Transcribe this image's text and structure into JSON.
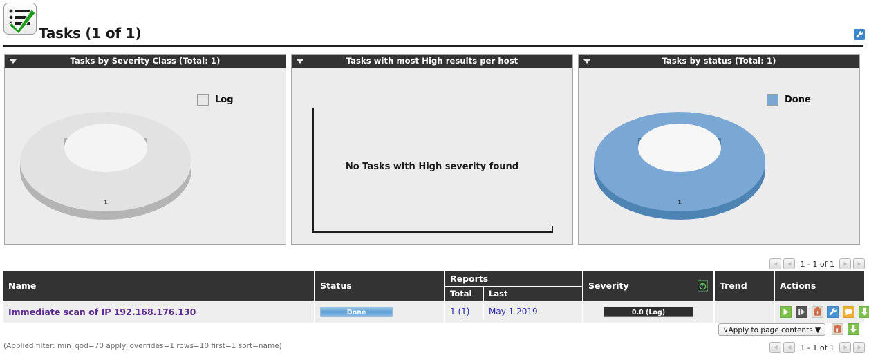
{
  "header": {
    "title": "Tasks (1 of 1)",
    "icon": "tasks-checklist-icon",
    "edit_icon": "wrench-icon"
  },
  "panels": [
    {
      "id": "severity-class",
      "title": "Tasks by Severity Class (Total: 1)",
      "toggle_icon": "chevron-down-icon",
      "legend": [
        {
          "label": "Log",
          "color": "#e6e6e6"
        }
      ],
      "value_label": "1"
    },
    {
      "id": "most-high-results",
      "title": "Tasks with most High results per host",
      "toggle_icon": "chevron-down-icon",
      "empty_message": "No Tasks with High severity found"
    },
    {
      "id": "by-status",
      "title": "Tasks by status (Total: 1)",
      "toggle_icon": "chevron-down-icon",
      "legend": [
        {
          "label": "Done",
          "color": "#7ba7d4"
        }
      ],
      "value_label": "1"
    }
  ],
  "chart_data": [
    {
      "type": "pie",
      "title": "Tasks by Severity Class (Total: 1)",
      "labels": [
        "Log"
      ],
      "values": [
        1
      ],
      "colors": [
        "#e6e6e6"
      ],
      "donut": true,
      "legend_position": "top-right",
      "data_labels": [
        "1"
      ],
      "total": 1
    },
    {
      "type": "bar",
      "title": "Tasks with most High results per host",
      "categories": [],
      "values": [],
      "xlabel": "",
      "ylabel": "",
      "grid": false,
      "empty_message": "No Tasks with High severity found"
    },
    {
      "type": "pie",
      "title": "Tasks by status (Total: 1)",
      "labels": [
        "Done"
      ],
      "values": [
        1
      ],
      "colors": [
        "#7ba7d4"
      ],
      "donut": true,
      "legend_position": "top-right",
      "data_labels": [
        "1"
      ],
      "total": 1
    }
  ],
  "pagination": {
    "range_label": "1 - 1 of 1",
    "first_icon": "first-page-icon",
    "prev_icon": "previous-page-icon",
    "next_icon": "next-page-icon",
    "last_icon": "last-page-icon"
  },
  "table": {
    "columns": {
      "name": "Name",
      "status": "Status",
      "reports": "Reports",
      "reports_total": "Total",
      "reports_last": "Last",
      "severity": "Severity",
      "trend": "Trend",
      "actions": "Actions"
    },
    "severity_override_icon": "overrides-enabled-icon",
    "rows": [
      {
        "name": "Immediate scan of IP 192.168.176.130",
        "status": "Done",
        "reports_total": "1 (1)",
        "reports_last": "May 1 2019",
        "severity": "0.0 (Log)",
        "trend": "",
        "actions": [
          {
            "name": "start-task-icon",
            "title": "Start"
          },
          {
            "name": "resume-task-icon",
            "title": "Resume"
          },
          {
            "name": "trash-icon",
            "title": "Move to Trashcan"
          },
          {
            "name": "edit-task-icon",
            "title": "Edit Task"
          },
          {
            "name": "clone-task-icon",
            "title": "Clone"
          },
          {
            "name": "export-task-icon",
            "title": "Export Task"
          }
        ]
      }
    ]
  },
  "footer": {
    "apply_to_page_contents": "∨Apply to page contents",
    "trash_icon": "trash-icon",
    "export_icon": "export-icon",
    "filter_note": "(Applied filter: min_qod=70 apply_overrides=1 rows=10 first=1 sort=name)"
  }
}
